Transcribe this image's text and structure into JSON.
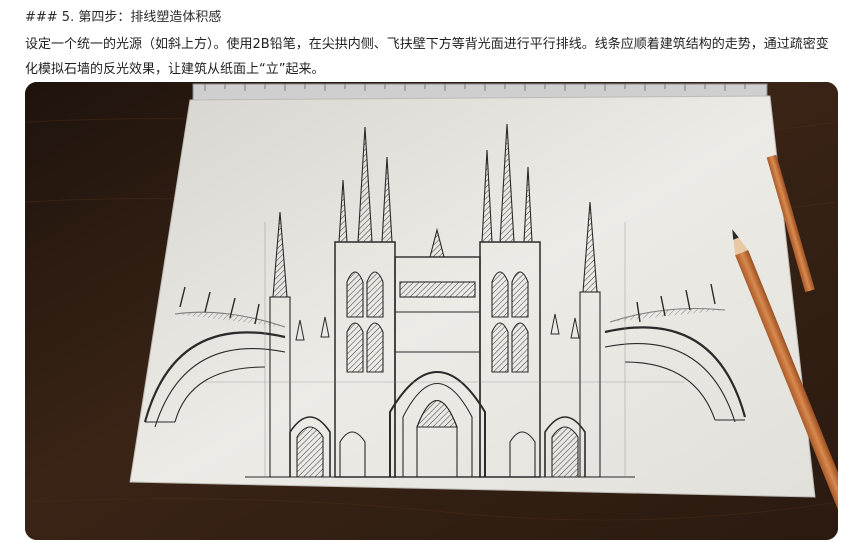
{
  "message": {
    "heading": "### 5. 第四步：排线塑造体积感",
    "paragraph": "设定一个统一的光源（如斜上方）。使用2B铅笔，在尖拱内侧、飞扶壁下方等背光面进行平行排线。线条应顺着建筑结构的走势，通过疏密变化模拟石墙的反光效果，让建筑从纸面上“立”起来。"
  },
  "image": {
    "subject": "pencil sketch of gothic cathedral on paper with ruler and pencil on wooden desk",
    "colors": {
      "wood_dark": "#2a1a10",
      "wood_light": "#5a3a24",
      "paper": "#e9e7e1",
      "pencil": "#c9763d",
      "ink": "#2a2a2a"
    }
  }
}
